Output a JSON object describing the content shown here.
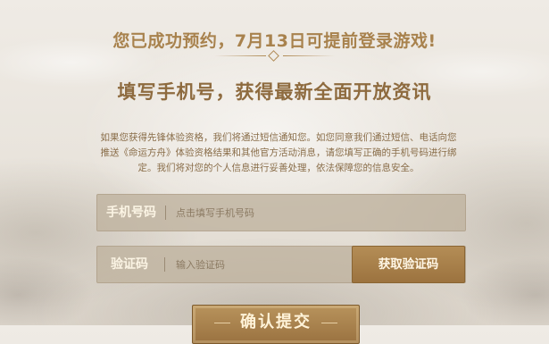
{
  "header": {
    "headline": "您已成功预约，7月13日可提前登录游戏!",
    "subtitle": "填写手机号，获得最新全面开放资讯"
  },
  "notice": {
    "line1": "如果您获得先锋体验资格，我们将通过短信通知您。如您同意我们通过短信、电话向您",
    "line2": "推送《命运方舟》体验资格结果和其他官方活动消息，请您填写正确的手机号码进行绑",
    "line3": "定。我们将对您的个人信息进行妥善处理，依法保障您的信息安全。"
  },
  "form": {
    "phone_label": "手机号码",
    "phone_placeholder": "点击填写手机号码",
    "phone_value": "",
    "code_label": "验证码",
    "code_placeholder": "输入验证码",
    "code_value": "",
    "get_code_label": "获取验证码",
    "submit_label": "确认提交"
  },
  "colors": {
    "accent_gold": "#a8824d",
    "button_brown": "#9c733f",
    "field_bg": "#bfb3a0"
  }
}
